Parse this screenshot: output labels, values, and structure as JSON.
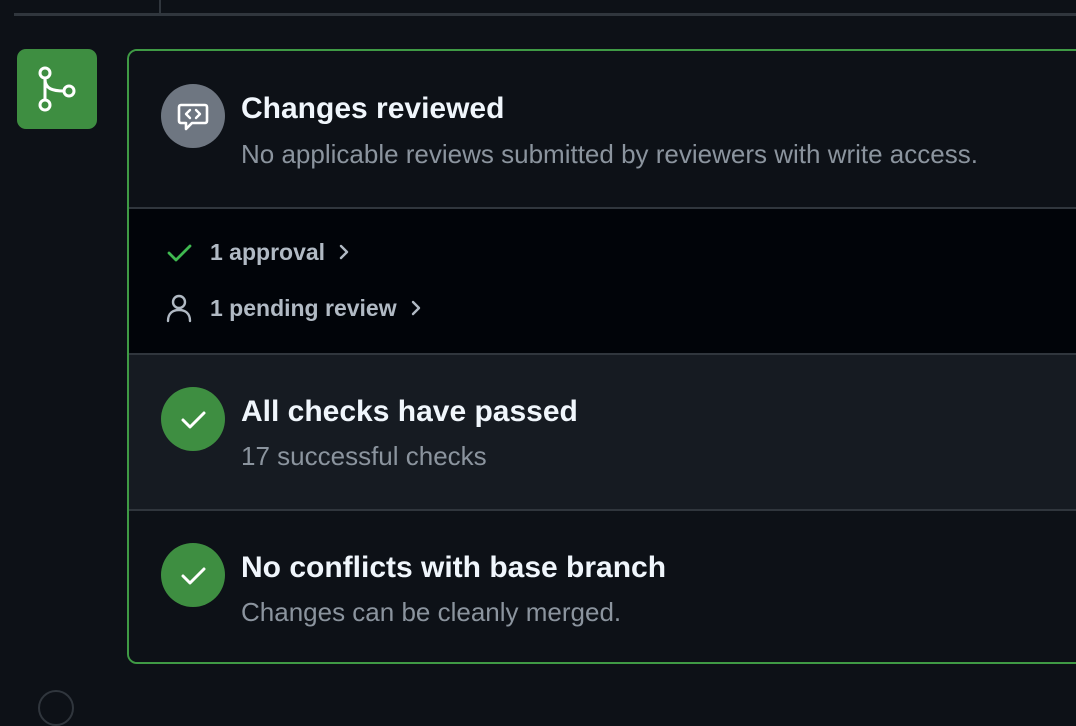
{
  "review": {
    "title": "Changes reviewed",
    "subtitle": "No applicable reviews submitted by reviewers with write access.",
    "icon": "code-review-icon"
  },
  "reviewers": {
    "approval_label": "1 approval",
    "pending_label": "1 pending review"
  },
  "checks": {
    "title": "All checks have passed",
    "subtitle": "17 successful checks",
    "icon": "check-icon"
  },
  "conflicts": {
    "title": "No conflicts with base branch",
    "subtitle": "Changes can be cleanly merged.",
    "icon": "check-icon"
  },
  "colors": {
    "success": "#3e8e41",
    "border": "#3f9a45",
    "neutral": "#6e7681",
    "background": "#0d1117"
  }
}
